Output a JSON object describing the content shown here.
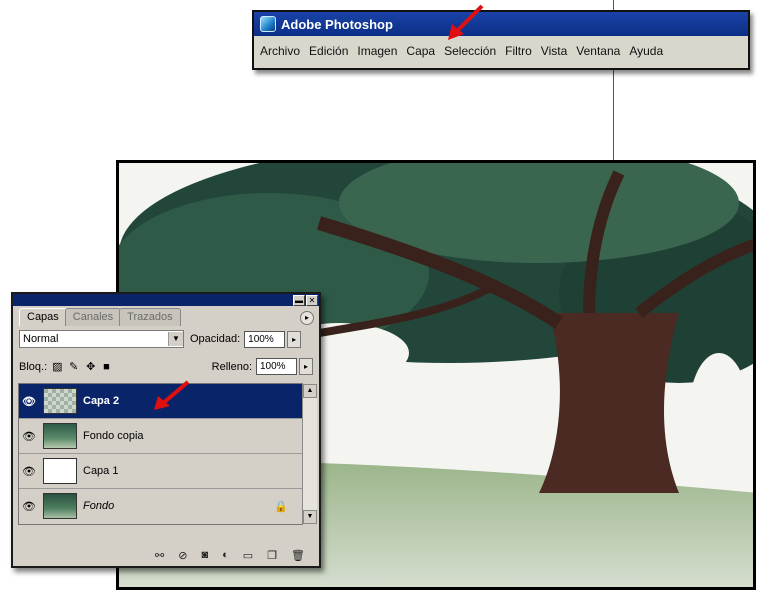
{
  "app": {
    "title": "Adobe Photoshop",
    "menu": [
      "Archivo",
      "Edición",
      "Imagen",
      "Capa",
      "Selección",
      "Filtro",
      "Vista",
      "Ventana",
      "Ayuda"
    ]
  },
  "palette": {
    "tabs": [
      "Capas",
      "Canales",
      "Trazados"
    ],
    "active_tab": "Capas",
    "blend_mode": "Normal",
    "opacity_label": "Opacidad:",
    "opacity_value": "100%",
    "lock_label": "Bloq.:",
    "fill_label": "Relleno:",
    "fill_value": "100%",
    "layers": [
      {
        "name": "Capa 2",
        "selected": true
      },
      {
        "name": "Fondo copia",
        "selected": false
      },
      {
        "name": "Capa 1",
        "selected": false
      },
      {
        "name": "Fondo",
        "selected": false,
        "locked": true
      }
    ]
  },
  "colors": {
    "title_bar": "#0b2f86",
    "selected_layer": "#0a246a",
    "arrow": "#e01010"
  }
}
